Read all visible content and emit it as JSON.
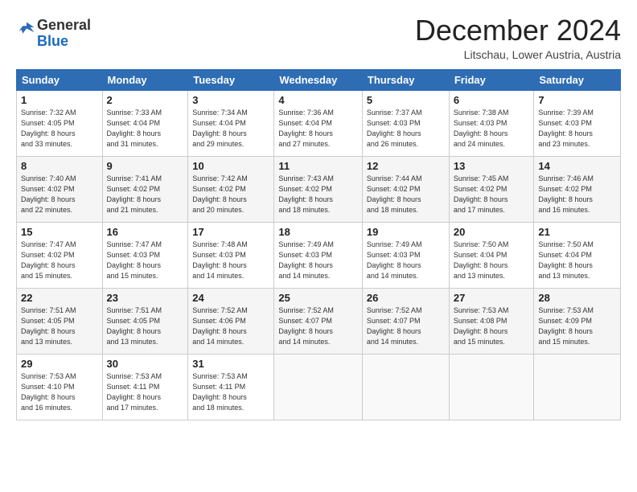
{
  "logo": {
    "general": "General",
    "blue": "Blue"
  },
  "title": "December 2024",
  "subtitle": "Litschau, Lower Austria, Austria",
  "days_header": [
    "Sunday",
    "Monday",
    "Tuesday",
    "Wednesday",
    "Thursday",
    "Friday",
    "Saturday"
  ],
  "weeks": [
    [
      {
        "day": "1",
        "info": "Sunrise: 7:32 AM\nSunset: 4:05 PM\nDaylight: 8 hours\nand 33 minutes."
      },
      {
        "day": "2",
        "info": "Sunrise: 7:33 AM\nSunset: 4:04 PM\nDaylight: 8 hours\nand 31 minutes."
      },
      {
        "day": "3",
        "info": "Sunrise: 7:34 AM\nSunset: 4:04 PM\nDaylight: 8 hours\nand 29 minutes."
      },
      {
        "day": "4",
        "info": "Sunrise: 7:36 AM\nSunset: 4:04 PM\nDaylight: 8 hours\nand 27 minutes."
      },
      {
        "day": "5",
        "info": "Sunrise: 7:37 AM\nSunset: 4:03 PM\nDaylight: 8 hours\nand 26 minutes."
      },
      {
        "day": "6",
        "info": "Sunrise: 7:38 AM\nSunset: 4:03 PM\nDaylight: 8 hours\nand 24 minutes."
      },
      {
        "day": "7",
        "info": "Sunrise: 7:39 AM\nSunset: 4:03 PM\nDaylight: 8 hours\nand 23 minutes."
      }
    ],
    [
      {
        "day": "8",
        "info": "Sunrise: 7:40 AM\nSunset: 4:02 PM\nDaylight: 8 hours\nand 22 minutes."
      },
      {
        "day": "9",
        "info": "Sunrise: 7:41 AM\nSunset: 4:02 PM\nDaylight: 8 hours\nand 21 minutes."
      },
      {
        "day": "10",
        "info": "Sunrise: 7:42 AM\nSunset: 4:02 PM\nDaylight: 8 hours\nand 20 minutes."
      },
      {
        "day": "11",
        "info": "Sunrise: 7:43 AM\nSunset: 4:02 PM\nDaylight: 8 hours\nand 18 minutes."
      },
      {
        "day": "12",
        "info": "Sunrise: 7:44 AM\nSunset: 4:02 PM\nDaylight: 8 hours\nand 18 minutes."
      },
      {
        "day": "13",
        "info": "Sunrise: 7:45 AM\nSunset: 4:02 PM\nDaylight: 8 hours\nand 17 minutes."
      },
      {
        "day": "14",
        "info": "Sunrise: 7:46 AM\nSunset: 4:02 PM\nDaylight: 8 hours\nand 16 minutes."
      }
    ],
    [
      {
        "day": "15",
        "info": "Sunrise: 7:47 AM\nSunset: 4:02 PM\nDaylight: 8 hours\nand 15 minutes."
      },
      {
        "day": "16",
        "info": "Sunrise: 7:47 AM\nSunset: 4:03 PM\nDaylight: 8 hours\nand 15 minutes."
      },
      {
        "day": "17",
        "info": "Sunrise: 7:48 AM\nSunset: 4:03 PM\nDaylight: 8 hours\nand 14 minutes."
      },
      {
        "day": "18",
        "info": "Sunrise: 7:49 AM\nSunset: 4:03 PM\nDaylight: 8 hours\nand 14 minutes."
      },
      {
        "day": "19",
        "info": "Sunrise: 7:49 AM\nSunset: 4:03 PM\nDaylight: 8 hours\nand 14 minutes."
      },
      {
        "day": "20",
        "info": "Sunrise: 7:50 AM\nSunset: 4:04 PM\nDaylight: 8 hours\nand 13 minutes."
      },
      {
        "day": "21",
        "info": "Sunrise: 7:50 AM\nSunset: 4:04 PM\nDaylight: 8 hours\nand 13 minutes."
      }
    ],
    [
      {
        "day": "22",
        "info": "Sunrise: 7:51 AM\nSunset: 4:05 PM\nDaylight: 8 hours\nand 13 minutes."
      },
      {
        "day": "23",
        "info": "Sunrise: 7:51 AM\nSunset: 4:05 PM\nDaylight: 8 hours\nand 13 minutes."
      },
      {
        "day": "24",
        "info": "Sunrise: 7:52 AM\nSunset: 4:06 PM\nDaylight: 8 hours\nand 14 minutes."
      },
      {
        "day": "25",
        "info": "Sunrise: 7:52 AM\nSunset: 4:07 PM\nDaylight: 8 hours\nand 14 minutes."
      },
      {
        "day": "26",
        "info": "Sunrise: 7:52 AM\nSunset: 4:07 PM\nDaylight: 8 hours\nand 14 minutes."
      },
      {
        "day": "27",
        "info": "Sunrise: 7:53 AM\nSunset: 4:08 PM\nDaylight: 8 hours\nand 15 minutes."
      },
      {
        "day": "28",
        "info": "Sunrise: 7:53 AM\nSunset: 4:09 PM\nDaylight: 8 hours\nand 15 minutes."
      }
    ],
    [
      {
        "day": "29",
        "info": "Sunrise: 7:53 AM\nSunset: 4:10 PM\nDaylight: 8 hours\nand 16 minutes."
      },
      {
        "day": "30",
        "info": "Sunrise: 7:53 AM\nSunset: 4:11 PM\nDaylight: 8 hours\nand 17 minutes."
      },
      {
        "day": "31",
        "info": "Sunrise: 7:53 AM\nSunset: 4:11 PM\nDaylight: 8 hours\nand 18 minutes."
      },
      null,
      null,
      null,
      null
    ]
  ]
}
